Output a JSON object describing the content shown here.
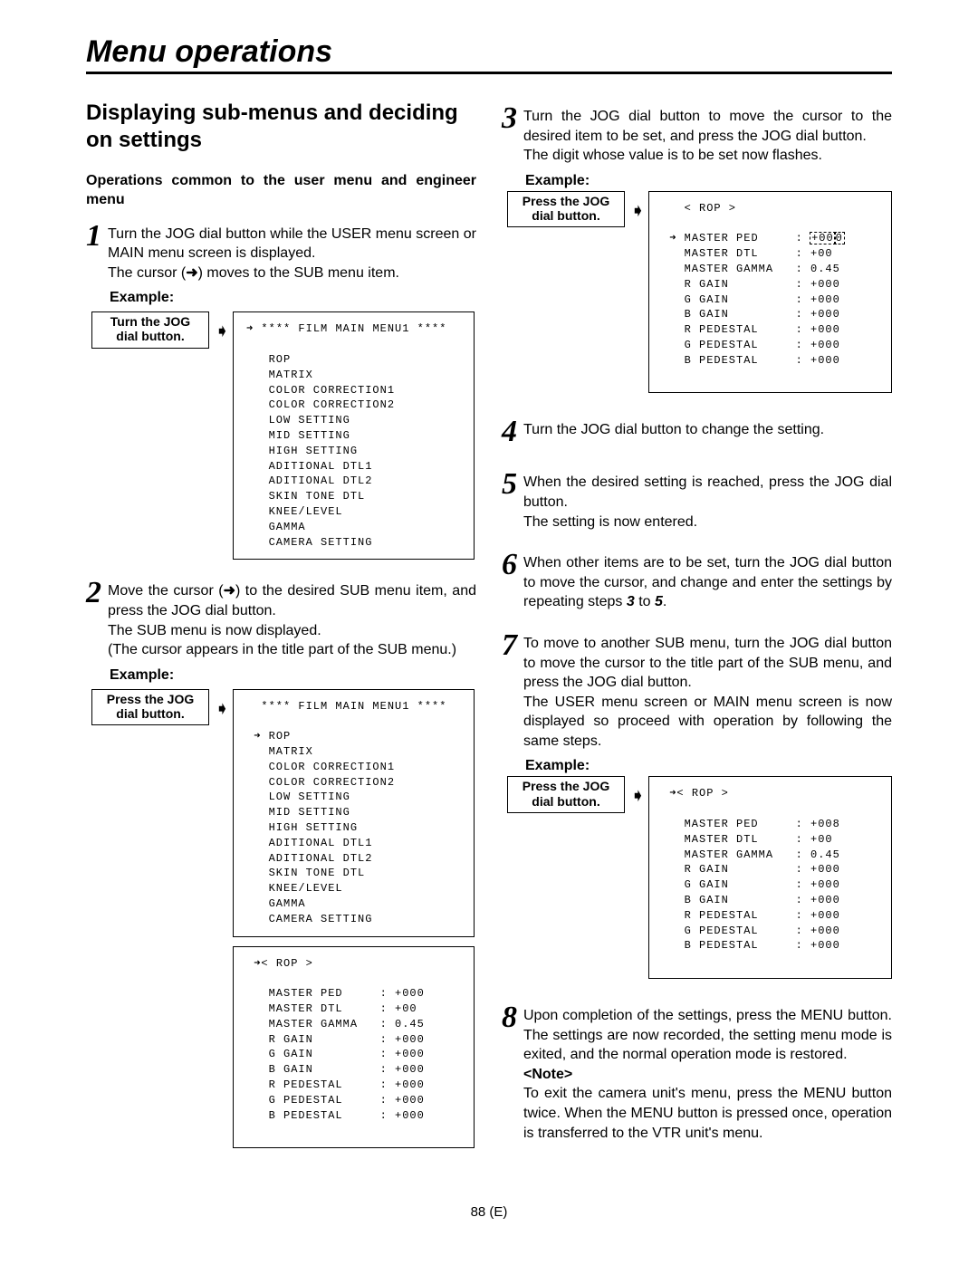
{
  "chapter_title": "Menu operations",
  "section_title": "Displaying sub-menus and deciding on settings",
  "sub_description": "Operations common to the user menu and engineer menu",
  "example_label": "Example:",
  "callouts": {
    "turn": {
      "line1": "Turn the JOG",
      "line2": "dial button."
    },
    "press": {
      "line1": "Press the JOG",
      "line2": "dial button."
    }
  },
  "steps": {
    "s1": {
      "num": "1",
      "body": "Turn the JOG dial button while the USER menu screen or MAIN menu screen is displayed.<br>The cursor (<span class=\"arrow-inline\">➜</span>) moves to the SUB menu item."
    },
    "s2": {
      "num": "2",
      "body": "Move the cursor (<span class=\"arrow-inline\">➜</span>) to the desired SUB menu item, and press the JOG dial button.<br>The SUB menu is now displayed.<br>(The cursor appears in the title part of the SUB menu.)"
    },
    "s3": {
      "num": "3",
      "body": "Turn the JOG dial button to move the cursor to the desired item to be set, and press the JOG dial button.<br>The digit whose value is to be set now flashes."
    },
    "s4": {
      "num": "4",
      "body": "Turn the JOG dial button to change the setting."
    },
    "s5": {
      "num": "5",
      "body": "When the desired setting is reached, press the JOG dial button.<br>The setting is now entered."
    },
    "s6": {
      "num": "6",
      "body": "When other items are to be set, turn the JOG dial button to move the cursor, and change and enter the settings by repeating steps <i><b>3</b></i> to <i><b>5</b></i>."
    },
    "s7": {
      "num": "7",
      "body": "To move to another SUB menu, turn the JOG dial button to move the cursor to the title part of the SUB menu, and press the JOG dial button.<br>The USER menu screen or MAIN menu screen is now displayed so proceed with operation by following the same steps."
    },
    "s8": {
      "num": "8",
      "body": "Upon completion of the settings, press the MENU button.  The settings are now recorded, the setting menu mode is exited, and the normal operation mode is restored.<br><b>&lt;Note&gt;</b><br>To exit the camera unit's menu, press the MENU button twice.  When the MENU button is pressed once, operation is transferred to the VTR unit's menu."
    }
  },
  "screens": {
    "main1": "➜ **** FILM MAIN MENU1 ****\n\n   ROP\n   MATRIX\n   COLOR CORRECTION1\n   COLOR CORRECTION2\n   LOW SETTING\n   MID SETTING\n   HIGH SETTING\n   ADITIONAL DTL1\n   ADITIONAL DTL2\n   SKIN TONE DTL\n   KNEE/LEVEL\n   GAMMA\n   CAMERA SETTING",
    "main2": "  **** FILM MAIN MENU1 ****\n\n ➜ ROP\n   MATRIX\n   COLOR CORRECTION1\n   COLOR CORRECTION2\n   LOW SETTING\n   MID SETTING\n   HIGH SETTING\n   ADITIONAL DTL1\n   ADITIONAL DTL2\n   SKIN TONE DTL\n   KNEE/LEVEL\n   GAMMA\n   CAMERA SETTING",
    "rop1": " ➜< ROP >\n\n   MASTER PED     : +000\n   MASTER DTL     : +00\n   MASTER GAMMA   : 0.45\n   R GAIN         : +000\n   G GAIN         : +000\n   B GAIN         : +000\n   R PEDESTAL     : +000\n   G PEDESTAL     : +000\n   B PEDESTAL     : +000\n\n",
    "rop3": {
      "title": "   < ROP >",
      "line1_label": " ➜ MASTER PED     :",
      "line1_val_body": "+00",
      "line1_val_last": "0",
      "line1_below": "-",
      "rest": "   MASTER DTL     : +00\n   MASTER GAMMA   : 0.45\n   R GAIN         : +000\n   G GAIN         : +000\n   B GAIN         : +000\n   R PEDESTAL     : +000\n   G PEDESTAL     : +000\n   B PEDESTAL     : +000\n\n"
    },
    "rop7": " ➜< ROP >\n\n   MASTER PED     : +008\n   MASTER DTL     : +00\n   MASTER GAMMA   : 0.45\n   R GAIN         : +000\n   G GAIN         : +000\n   B GAIN         : +000\n   R PEDESTAL     : +000\n   G PEDESTAL     : +000\n   B PEDESTAL     : +000\n\n"
  },
  "footer": "88 (E)"
}
